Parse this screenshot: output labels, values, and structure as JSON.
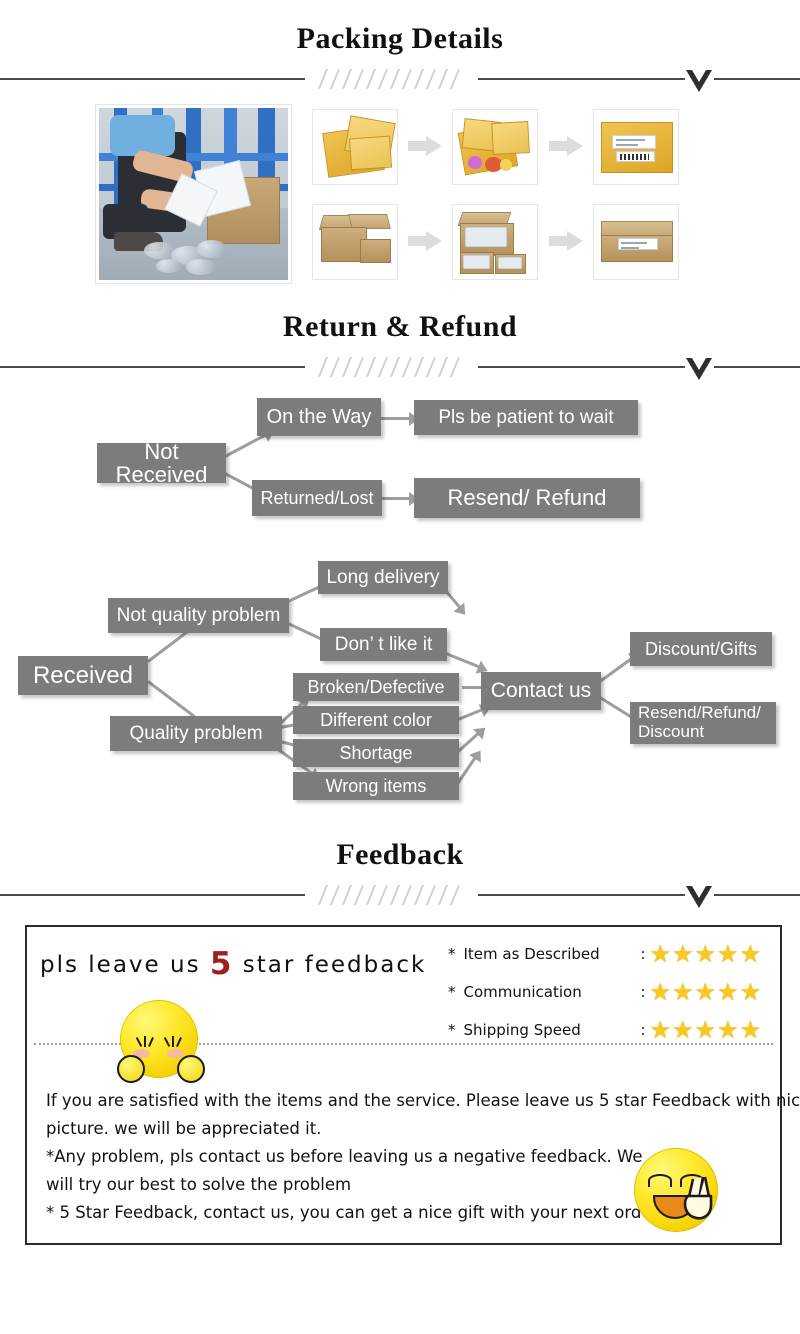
{
  "sections": {
    "packing": {
      "title": "Packing Details"
    },
    "return": {
      "title": "Return & Refund"
    },
    "feedback": {
      "title": "Feedback"
    }
  },
  "packing": {
    "photo_alt": "worker-packing-photo",
    "steps": [
      {
        "name": "bubble-mailer-empty"
      },
      {
        "name": "bubble-mailer-with-items"
      },
      {
        "name": "bubble-mailer-sealed-labeled"
      },
      {
        "name": "carton-boxes-empty"
      },
      {
        "name": "carton-box-filled"
      },
      {
        "name": "carton-box-sealed-labeled"
      }
    ],
    "arrow_icon": "right-arrow-icon"
  },
  "flow_not_received": {
    "nodes": [
      {
        "id": "not-received",
        "label": "Not Received"
      },
      {
        "id": "on-the-way",
        "label": "On the Way"
      },
      {
        "id": "pls-be-patient",
        "label": "Pls be patient to wait"
      },
      {
        "id": "returned-lost",
        "label": "Returned/Lost"
      },
      {
        "id": "resend-refund",
        "label": "Resend/ Refund"
      }
    ]
  },
  "flow_received": {
    "nodes": [
      {
        "id": "received",
        "label": "Received"
      },
      {
        "id": "not-quality-problem",
        "label": "Not quality problem"
      },
      {
        "id": "quality-problem",
        "label": "Quality problem"
      },
      {
        "id": "long-delivery",
        "label": "Long delivery"
      },
      {
        "id": "dont-like-it",
        "label": "Don’  t like it"
      },
      {
        "id": "broken-defective",
        "label": "Broken/Defective"
      },
      {
        "id": "different-color",
        "label": "Different color"
      },
      {
        "id": "shortage",
        "label": "Shortage"
      },
      {
        "id": "wrong-items",
        "label": "Wrong items"
      },
      {
        "id": "contact-us",
        "label": "Contact us"
      },
      {
        "id": "discount-gifts",
        "label": "Discount/Gifts"
      },
      {
        "id": "resend-refund-discount",
        "label": "Resend/Refund/\nDiscount"
      }
    ]
  },
  "feedback": {
    "headline_pre": "pls  leave  us  ",
    "headline_num": "5",
    "headline_post": "  star  feedback",
    "ratings": [
      {
        "asterisk": "*",
        "label": "Item as Described",
        "colon": ":",
        "stars": 5
      },
      {
        "asterisk": "*",
        "label": "Communication",
        "colon": ":",
        "stars": 5
      },
      {
        "asterisk": "*",
        "label": "Shipping Speed",
        "colon": ":",
        "stars": 5
      }
    ],
    "star_glyph": "★",
    "star_color": "#fbc81e",
    "five_color": "#9d2020",
    "lines": [
      "If you are satisfied with the items and the service. Please leave us 5 star Feedback with nice",
      "picture. we will be appreciated it.",
      "*Any problem, pls contact us before leaving us a negative feedback. We",
      "will try our best to solve  the problem",
      "* 5 Star Feedback, contact us, you can get a nice gift with your next order."
    ],
    "emojis": [
      {
        "name": "shy-blush-emoji"
      },
      {
        "name": "smiling-peace-sign-emoji"
      }
    ]
  },
  "colors": {
    "node_bg": "#7c7c7c",
    "rule": "#4a4a4a",
    "hatch": "#cfcfcf",
    "arrow": "#9d9d9d",
    "mailer": "#dda527",
    "carton": "#b5925c"
  }
}
